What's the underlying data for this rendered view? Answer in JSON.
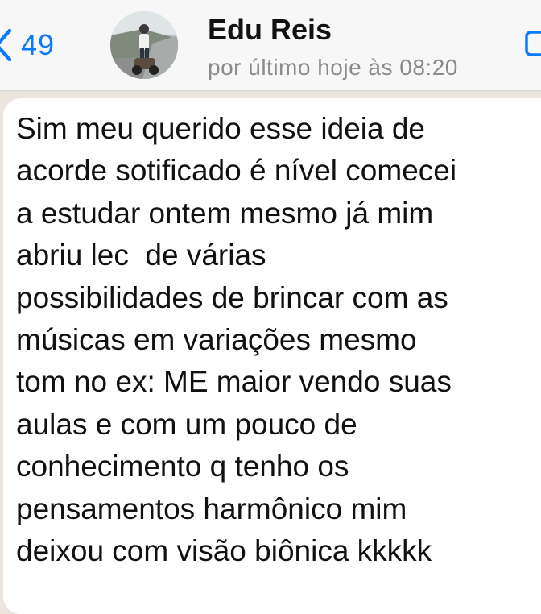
{
  "header": {
    "back_count": "49",
    "contact_name": "Edu Reis",
    "last_seen": "por último hoje às 08:20"
  },
  "icons": {
    "back": "chevron-left-icon",
    "avatar": "profile-photo",
    "video": "video-call-icon"
  },
  "colors": {
    "accent": "#0a7aff",
    "background": "#ebe5de",
    "bubble": "#ffffff",
    "header": "#f7f7f7"
  },
  "message": {
    "lines": [
      "Sim meu querido esse ideia de",
      "acorde sotificado é nível comecei",
      "a estudar ontem mesmo já mim",
      "abriu lec  de várias",
      "possibilidades de brincar com as",
      "músicas em variações mesmo",
      "tom no ex: ME maior vendo suas",
      "aulas e com um pouco de",
      "conhecimento q tenho os",
      "pensamentos harmônico mim",
      "deixou com visão biônica kkkkk"
    ]
  }
}
